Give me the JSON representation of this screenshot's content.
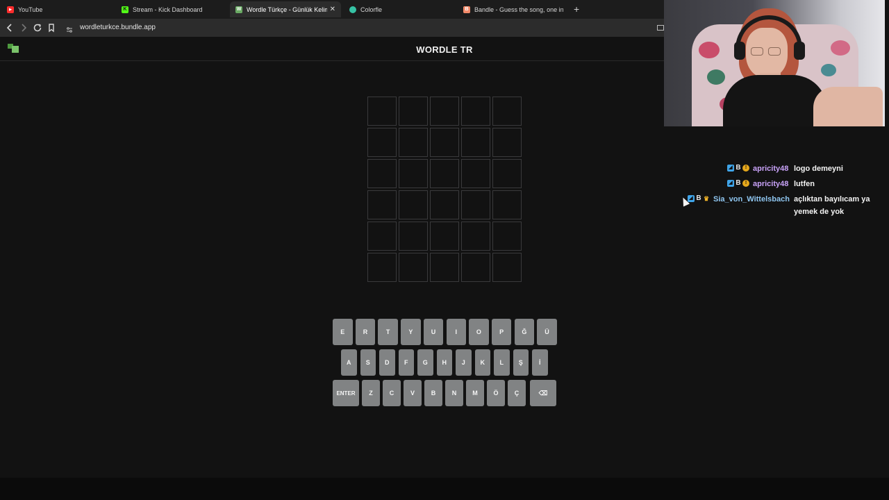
{
  "browser": {
    "tabs": [
      {
        "title": "YouTube",
        "favicon": "youtube-icon",
        "color": "#ff2d2d",
        "glyph": "▶"
      },
      {
        "title": "Stream - Kick Dashboard",
        "favicon": "kick-icon",
        "color": "#53fc18",
        "glyph": "K"
      },
      {
        "title": "Wordle Türkçe - Günlük Kelime (",
        "favicon": "wordle-icon",
        "color": "#6aaa64",
        "glyph": "W",
        "active": true
      },
      {
        "title": "Colorfle",
        "favicon": "colorfle-icon",
        "color": "#36c2a4",
        "glyph": ""
      },
      {
        "title": "Bandle - Guess the song, one instrum",
        "favicon": "bandle-icon",
        "color": "#f28b6b",
        "glyph": "B"
      }
    ],
    "url": "wordleturkce.bundle.app",
    "close_glyph": "✕",
    "new_tab_glyph": "+"
  },
  "page": {
    "title": "WORDLE TR"
  },
  "board": {
    "rows": 6,
    "cols": 5
  },
  "keyboard": {
    "row1": [
      "E",
      "R",
      "T",
      "Y",
      "U",
      "I",
      "O",
      "P",
      "Ğ",
      "Ü"
    ],
    "row2": [
      "A",
      "S",
      "D",
      "F",
      "G",
      "H",
      "J",
      "K",
      "L",
      "Ş",
      "İ"
    ],
    "row3": [
      "ENTER",
      "Z",
      "C",
      "V",
      "B",
      "N",
      "M",
      "Ö",
      "Ç",
      "⌫"
    ],
    "key_color": "#818384"
  },
  "chat": {
    "messages": [
      {
        "user": "apricity48",
        "user_color": "#c8a2f8",
        "text": "logo demeyni",
        "badges": [
          "blue",
          "b",
          "gold"
        ]
      },
      {
        "user": "apricity48",
        "user_color": "#c8a2f8",
        "text": "lutfen",
        "badges": [
          "blue",
          "b",
          "gold"
        ]
      },
      {
        "user": "Sia_von_Wittelsbach",
        "user_color": "#8fc6f0",
        "text_line1": "açlıktan bayılıcam ya",
        "text_line2": "yemek de yok",
        "badges": [
          "blue",
          "b",
          "crown"
        ]
      }
    ]
  }
}
